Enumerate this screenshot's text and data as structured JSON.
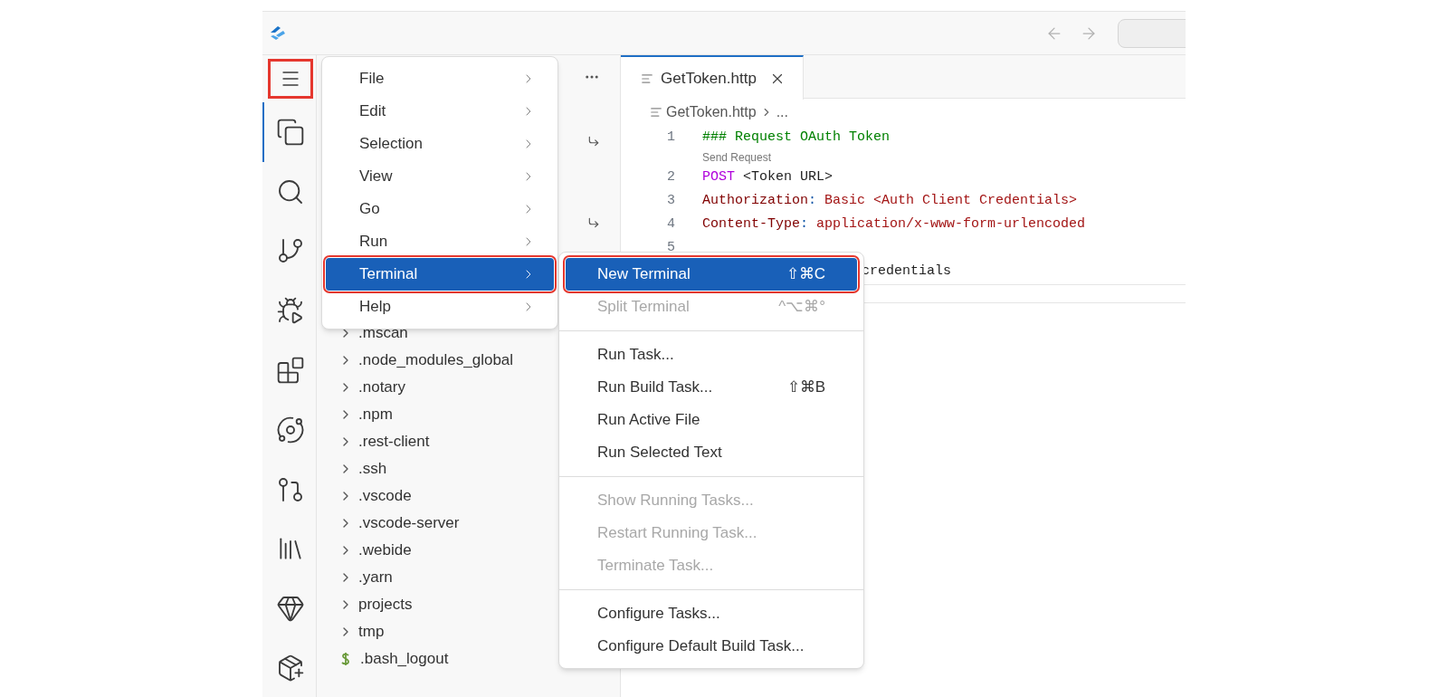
{
  "activity_bar": {
    "items": [
      {
        "kind": "menu",
        "selected": false,
        "annotated": true
      },
      {
        "kind": "explorer",
        "selected": true,
        "annotated": false
      },
      {
        "kind": "search",
        "selected": false,
        "annotated": false
      },
      {
        "kind": "scm",
        "selected": false,
        "annotated": false
      },
      {
        "kind": "debug",
        "selected": false,
        "annotated": false
      },
      {
        "kind": "extensions",
        "selected": false,
        "annotated": false
      },
      {
        "kind": "orbit",
        "selected": false,
        "annotated": false
      },
      {
        "kind": "pullrequest",
        "selected": false,
        "annotated": false
      },
      {
        "kind": "library",
        "selected": false,
        "annotated": false
      },
      {
        "kind": "gem",
        "selected": false,
        "annotated": false
      },
      {
        "kind": "package",
        "selected": false,
        "annotated": false
      }
    ]
  },
  "sidebar": {
    "tree": [
      {
        "name": ".mscan",
        "kind": "folder"
      },
      {
        "name": ".node_modules_global",
        "kind": "folder"
      },
      {
        "name": ".notary",
        "kind": "folder"
      },
      {
        "name": ".npm",
        "kind": "folder"
      },
      {
        "name": ".rest-client",
        "kind": "folder"
      },
      {
        "name": ".ssh",
        "kind": "folder"
      },
      {
        "name": ".vscode",
        "kind": "folder"
      },
      {
        "name": ".vscode-server",
        "kind": "folder"
      },
      {
        "name": ".webide",
        "kind": "folder"
      },
      {
        "name": ".yarn",
        "kind": "folder"
      },
      {
        "name": "projects",
        "kind": "folder"
      },
      {
        "name": "tmp",
        "kind": "folder"
      },
      {
        "name": ".bash_logout",
        "kind": "shell"
      }
    ]
  },
  "editor": {
    "tabs": [
      {
        "label": "GetToken.http",
        "selected": true
      }
    ],
    "breadcrumb": [
      "GetToken.http",
      "..."
    ],
    "lines": [
      {
        "number": "1",
        "tokens": [
          {
            "text": "### Request OAuth Token",
            "kind": "comment"
          }
        ],
        "lens": "Send Request"
      },
      {
        "number": "2",
        "tokens": [
          {
            "text": "POST",
            "kind": "keyword"
          },
          {
            "text": " <Token URL>",
            "kind": "plain"
          }
        ]
      },
      {
        "number": "3",
        "tokens": [
          {
            "text": "Authorization",
            "kind": "header"
          },
          {
            "text": ":",
            "kind": "punct"
          },
          {
            "text": " Basic <Auth Client Credentials>",
            "kind": "value"
          }
        ]
      },
      {
        "number": "4",
        "tokens": [
          {
            "text": "Content-Type",
            "kind": "header"
          },
          {
            "text": ":",
            "kind": "punct"
          },
          {
            "text": " application/x-www-form-urlencoded",
            "kind": "value"
          }
        ]
      },
      {
        "number": "5"
      },
      {
        "tokens": [
          {
            "text": "credentials",
            "kind": "plain"
          }
        ],
        "covered": true
      }
    ]
  },
  "menu": {
    "items": [
      {
        "label": "File",
        "selected": false,
        "annotated": false
      },
      {
        "label": "Edit",
        "selected": false,
        "annotated": false
      },
      {
        "label": "Selection",
        "selected": false,
        "annotated": false
      },
      {
        "label": "View",
        "selected": false,
        "annotated": false
      },
      {
        "label": "Go",
        "selected": false,
        "annotated": false
      },
      {
        "label": "Run",
        "selected": false,
        "annotated": false
      },
      {
        "label": "Terminal",
        "selected": true,
        "annotated": true
      },
      {
        "label": "Help",
        "selected": false,
        "annotated": false
      }
    ]
  },
  "submenu": {
    "groups": [
      [
        {
          "label": "New Terminal",
          "shortcut": "⇧⌘C",
          "disabled": false,
          "selected": true,
          "annotated": true
        },
        {
          "label": "Split Terminal",
          "shortcut": "^⌥⌘°",
          "disabled": true,
          "selected": false,
          "annotated": false
        }
      ],
      [
        {
          "label": "Run Task...",
          "disabled": false,
          "selected": false,
          "annotated": false
        },
        {
          "label": "Run Build Task...",
          "shortcut": "⇧⌘B",
          "disabled": false,
          "selected": false,
          "annotated": false
        },
        {
          "label": "Run Active File",
          "disabled": false,
          "selected": false,
          "annotated": false
        },
        {
          "label": "Run Selected Text",
          "disabled": false,
          "selected": false,
          "annotated": false
        }
      ],
      [
        {
          "label": "Show Running Tasks...",
          "disabled": true,
          "selected": false,
          "annotated": false
        },
        {
          "label": "Restart Running Task...",
          "disabled": true,
          "selected": false,
          "annotated": false
        },
        {
          "label": "Terminate Task...",
          "disabled": true,
          "selected": false,
          "annotated": false
        }
      ],
      [
        {
          "label": "Configure Tasks...",
          "disabled": false,
          "selected": false,
          "annotated": false
        },
        {
          "label": "Configure Default Build Task...",
          "disabled": false,
          "selected": false,
          "annotated": false
        }
      ]
    ]
  }
}
